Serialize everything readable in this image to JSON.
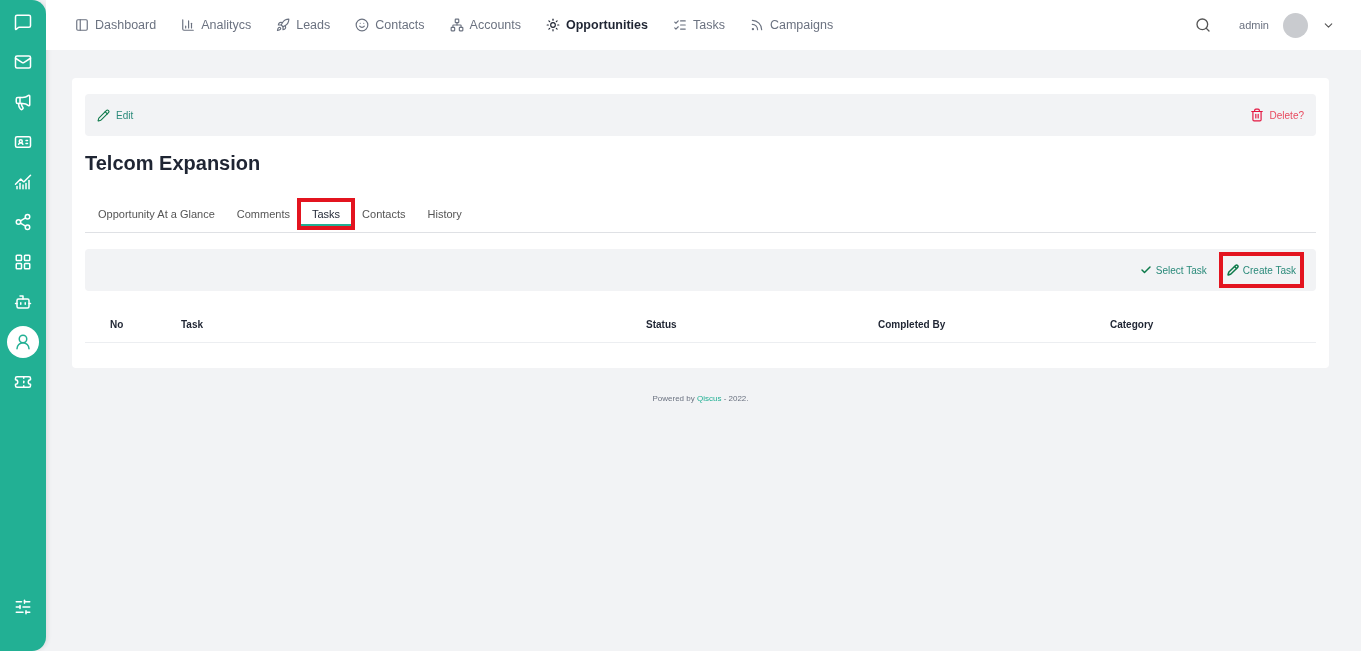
{
  "sidebar": {
    "items": [
      {
        "selected": false
      },
      {
        "selected": false
      },
      {
        "selected": false
      },
      {
        "selected": false
      },
      {
        "selected": false
      },
      {
        "selected": false
      },
      {
        "selected": false
      },
      {
        "selected": false
      },
      {
        "selected": true
      },
      {
        "selected": false
      }
    ]
  },
  "nav": {
    "items": [
      {
        "label": "Dashboard",
        "selected": false
      },
      {
        "label": "Analitycs",
        "selected": false
      },
      {
        "label": "Leads",
        "selected": false
      },
      {
        "label": "Contacts",
        "selected": false
      },
      {
        "label": "Accounts",
        "selected": false
      },
      {
        "label": "Opportunities",
        "selected": true
      },
      {
        "label": "Tasks",
        "selected": false
      },
      {
        "label": "Campaigns",
        "selected": false
      }
    ],
    "user": "admin"
  },
  "actions": {
    "edit": "Edit",
    "delete": "Delete?"
  },
  "title": "Telcom Expansion",
  "tabs": [
    {
      "label": "Opportunity At a Glance",
      "selected": false,
      "highlighted": false
    },
    {
      "label": "Comments",
      "selected": false,
      "highlighted": false
    },
    {
      "label": "Tasks",
      "selected": true,
      "highlighted": true
    },
    {
      "label": "Contacts",
      "selected": false,
      "highlighted": false
    },
    {
      "label": "History",
      "selected": false,
      "highlighted": false
    }
  ],
  "toolbar": [
    {
      "label": "Select Task",
      "highlighted": false
    },
    {
      "label": "Create Task",
      "highlighted": true
    }
  ],
  "table": {
    "columns": [
      "No",
      "Task",
      "Status",
      "Completed By",
      "Category"
    ]
  },
  "footer": {
    "prefix": "Powered by",
    "link": "Qiscus",
    "suffix": "- 2022."
  }
}
